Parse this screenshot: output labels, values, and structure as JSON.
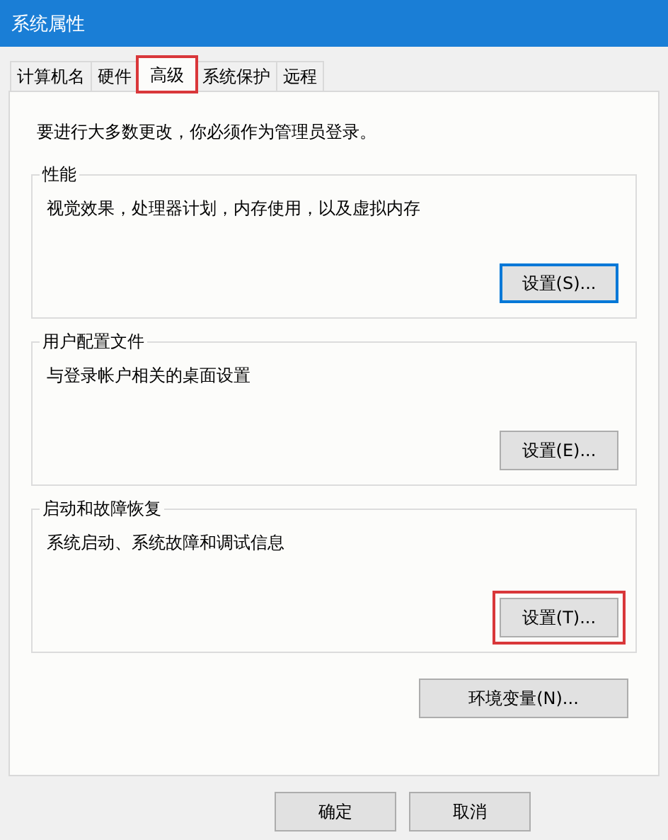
{
  "window": {
    "title": "系统属性"
  },
  "tabs": [
    {
      "label": "计算机名",
      "selected": false,
      "highlighted": false
    },
    {
      "label": "硬件",
      "selected": false,
      "highlighted": false
    },
    {
      "label": "高级",
      "selected": true,
      "highlighted": true
    },
    {
      "label": "系统保护",
      "selected": false,
      "highlighted": false
    },
    {
      "label": "远程",
      "selected": false,
      "highlighted": false
    }
  ],
  "notice": "要进行大多数更改，你必须作为管理员登录。",
  "groups": [
    {
      "title": "性能",
      "description": "视觉效果，处理器计划，内存使用，以及虚拟内存",
      "button": {
        "label": "设置(S)...",
        "focused": true,
        "highlighted": false
      }
    },
    {
      "title": "用户配置文件",
      "description": "与登录帐户相关的桌面设置",
      "button": {
        "label": "设置(E)...",
        "focused": false,
        "highlighted": false
      }
    },
    {
      "title": "启动和故障恢复",
      "description": "系统启动、系统故障和调试信息",
      "button": {
        "label": "设置(T)...",
        "focused": false,
        "highlighted": true
      }
    }
  ],
  "env_button": "环境变量(N)...",
  "dialog_buttons": [
    "确定",
    "取消"
  ]
}
